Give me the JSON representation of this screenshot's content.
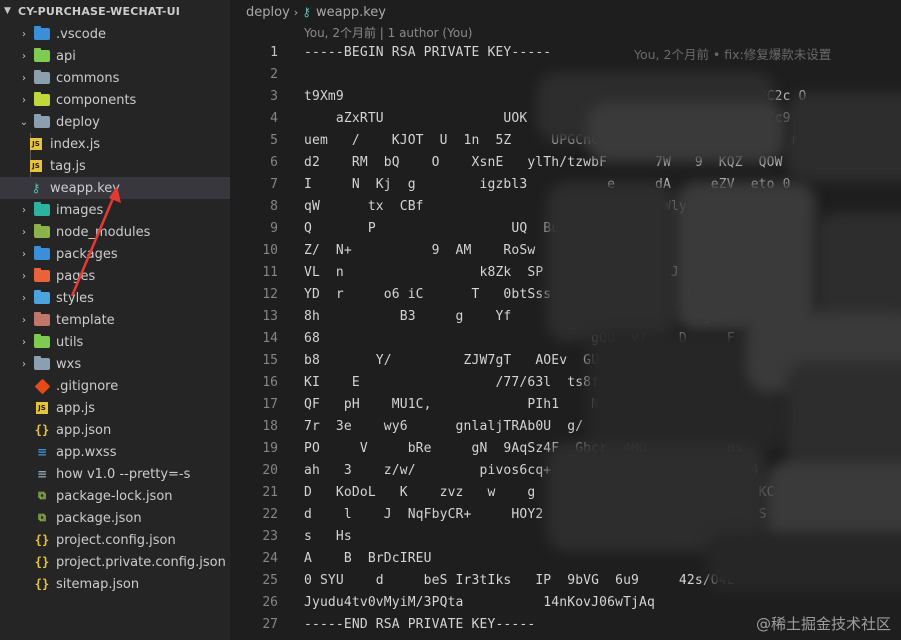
{
  "explorer": {
    "root": "CY-PURCHASE-WECHAT-UI",
    "items": [
      {
        "label": ".vscode",
        "icon": "vscode-folder-icon",
        "color": "#3a8fd8",
        "kind": "folder"
      },
      {
        "label": "api",
        "icon": "api-folder-icon",
        "color": "#7ecb52",
        "kind": "folder"
      },
      {
        "label": "commons",
        "icon": "folder-icon",
        "color": "#8a9fb0",
        "kind": "folder"
      },
      {
        "label": "components",
        "icon": "components-folder-icon",
        "color": "#c0d83c",
        "kind": "folder"
      },
      {
        "label": "deploy",
        "icon": "folder-open-icon",
        "color": "#8a9fb0",
        "kind": "folder-open"
      },
      {
        "label": "index.js",
        "icon": "js-file-icon",
        "kind": "js",
        "child": true
      },
      {
        "label": "tag.js",
        "icon": "js-file-icon",
        "kind": "js",
        "child": true
      },
      {
        "label": "weapp.key",
        "icon": "key-file-icon",
        "kind": "key",
        "child": true,
        "selected": true
      },
      {
        "label": "images",
        "icon": "images-folder-icon",
        "color": "#2eb2a0",
        "kind": "folder"
      },
      {
        "label": "node_modules",
        "icon": "node-modules-folder-icon",
        "color": "#8ab34b",
        "kind": "folder"
      },
      {
        "label": "packages",
        "icon": "packages-folder-icon",
        "color": "#3a8fd8",
        "kind": "folder"
      },
      {
        "label": "pages",
        "icon": "pages-folder-icon",
        "color": "#e8633a",
        "kind": "folder"
      },
      {
        "label": "styles",
        "icon": "styles-folder-icon",
        "color": "#4aa4e0",
        "kind": "folder"
      },
      {
        "label": "template",
        "icon": "template-folder-icon",
        "color": "#c0776a",
        "kind": "folder"
      },
      {
        "label": "utils",
        "icon": "utils-folder-icon",
        "color": "#7ecb52",
        "kind": "folder"
      },
      {
        "label": "wxs",
        "icon": "folder-icon",
        "color": "#8a9fb0",
        "kind": "folder"
      },
      {
        "label": ".gitignore",
        "icon": "git-file-icon",
        "kind": "git"
      },
      {
        "label": "app.js",
        "icon": "js-file-icon",
        "kind": "js"
      },
      {
        "label": "app.json",
        "icon": "json-file-icon",
        "kind": "json"
      },
      {
        "label": "app.wxss",
        "icon": "css-file-icon",
        "kind": "css"
      },
      {
        "label": "how v1.0 --pretty=-s",
        "icon": "text-file-icon",
        "kind": "txt"
      },
      {
        "label": "package-lock.json",
        "icon": "npm-file-icon",
        "kind": "npm"
      },
      {
        "label": "package.json",
        "icon": "npm-file-icon",
        "kind": "npm"
      },
      {
        "label": "project.config.json",
        "icon": "json-file-icon",
        "kind": "json"
      },
      {
        "label": "project.private.config.json",
        "icon": "json-file-icon",
        "kind": "json"
      },
      {
        "label": "sitemap.json",
        "icon": "json-file-icon",
        "kind": "json"
      }
    ]
  },
  "editor": {
    "breadcrumb": [
      "deploy",
      "weapp.key"
    ],
    "blame_header": "You, 2个月前 | 1 author (You)",
    "inline_blame": "You, 2个月前 • fix:修复爆款未设置",
    "lines": [
      {
        "n": "1",
        "text": "-----BEGIN RSA PRIVATE KEY-----"
      },
      {
        "n": "2",
        "text": ""
      },
      {
        "n": "3",
        "text": "t9Xm9                                                   xPC2c O"
      },
      {
        "n": "4",
        "text": "    aZxRTU               UOK          +6  ifUrz    X/xiTop/c9 iwu J"
      },
      {
        "n": "5",
        "text": "uem   /    KJOT  U  1n  5Z     UPGCnC  MqmpU     9           r"
      },
      {
        "n": "6",
        "text": "d2    RM  bQ    O    XsnE   ylTh/tzwbF      7W   9  KQZ  QOW"
      },
      {
        "n": "7",
        "text": "I     N  Kj  g        igzbl3          e     dA     eZV  eto 0"
      },
      {
        "n": "8",
        "text": "qW      tx  CBf                  /+H       1TWly      ty   kY"
      },
      {
        "n": "9",
        "text": "Q       P                 UQ  BuY+       z1A      Na  C9KuY"
      },
      {
        "n": "10",
        "text": "Z/  N+          9  AM    RoSw   g  WJ   Bg      CU 2ZEVC"
      },
      {
        "n": "11",
        "text": "VL  n                 k8Zk  SP   kwP0  d   f  J        hWaF"
      },
      {
        "n": "12",
        "text": "YD  r     o6 iC      T   0btSss   LLkZHN  x     E6fy  V"
      },
      {
        "n": "13",
        "text": "8h          B3     g    Yf       K1Nm1cw          gh/F  E"
      },
      {
        "n": "14",
        "text": "68                                  gQU  V7    D     F"
      },
      {
        "n": "15",
        "text": "b8       Y/         ZJW7gT   AOEv  GU   Al   H  N58   Y"
      },
      {
        "n": "16",
        "text": "KI    E                 /77/63l  ts8f+  RTHy  64     XKpox2"
      },
      {
        "n": "17",
        "text": "QF   pH    MU1C,            PIh1    N     g8   bQLe   S"
      },
      {
        "n": "18",
        "text": "7r  3e    wy6      gnlaljTRAb0U  g/     L          bX"
      },
      {
        "n": "19",
        "text": "PO     V     bRe     gN  9AqSz4F  Gbcr  4MD          ds"
      },
      {
        "n": "20",
        "text": "ah   3    z/w/        pivos6cq+              L          4"
      },
      {
        "n": "21",
        "text": "D   KoDoL   K    zvz   w    g            nc      J  Y    KC"
      },
      {
        "n": "22",
        "text": "d    l    J  NqFbyCR+     HOY2         kKkY           F  S"
      },
      {
        "n": "23",
        "text": "s   Hs                                        nAbr  r  3"
      },
      {
        "n": "24",
        "text": "A    B  BrDcIREU                                       4"
      },
      {
        "n": "25",
        "text": "0 SYU    d     beS Ir3tIks   IP  9bVG  6u9     42s/O4E"
      },
      {
        "n": "26",
        "text": "Jyudu4tv0vMyiM/3PQta          14nKovJ06wTjAq"
      },
      {
        "n": "27",
        "text": "-----END RSA PRIVATE KEY-----"
      }
    ]
  },
  "watermark": "@稀土掘金技术社区"
}
